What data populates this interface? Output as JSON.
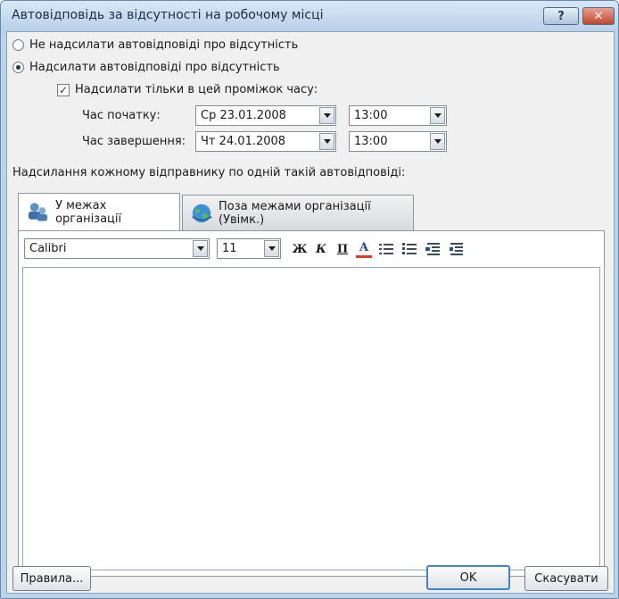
{
  "window": {
    "title": "Автовідповідь за відсутності на робочому місці",
    "help_glyph": "?",
    "close_glyph": "✕"
  },
  "options": {
    "no_reply_label": "Не надсилати автовідповіді про відсутність",
    "send_reply_label": "Надсилати автовідповіді про відсутність",
    "time_range_label": "Надсилати тільки в цей проміжок часу:",
    "start_label": "Час початку:",
    "end_label": "Час завершення:",
    "start_date": "Ср 23.01.2008",
    "start_time": "13:00",
    "end_date": "Чт 24.01.2008",
    "end_time": "13:00",
    "check_glyph": "✓"
  },
  "section": {
    "heading": "Надсилання кожному відправнику по одній такій автовідповіді:"
  },
  "tabs": [
    {
      "label": "У межах організації"
    },
    {
      "label": "Поза межами організації (Увімк.)"
    }
  ],
  "toolbar": {
    "font": "Calibri",
    "size": "11",
    "bold_glyph": "Ж",
    "italic_glyph": "К",
    "underline_glyph": "П",
    "color_glyph": "А"
  },
  "buttons": {
    "rules": "Правила...",
    "ok": "OK",
    "cancel": "Скасувати"
  },
  "colors": {
    "font_color_bar": "#e2382a",
    "titlebar": "#c7dcf1"
  }
}
